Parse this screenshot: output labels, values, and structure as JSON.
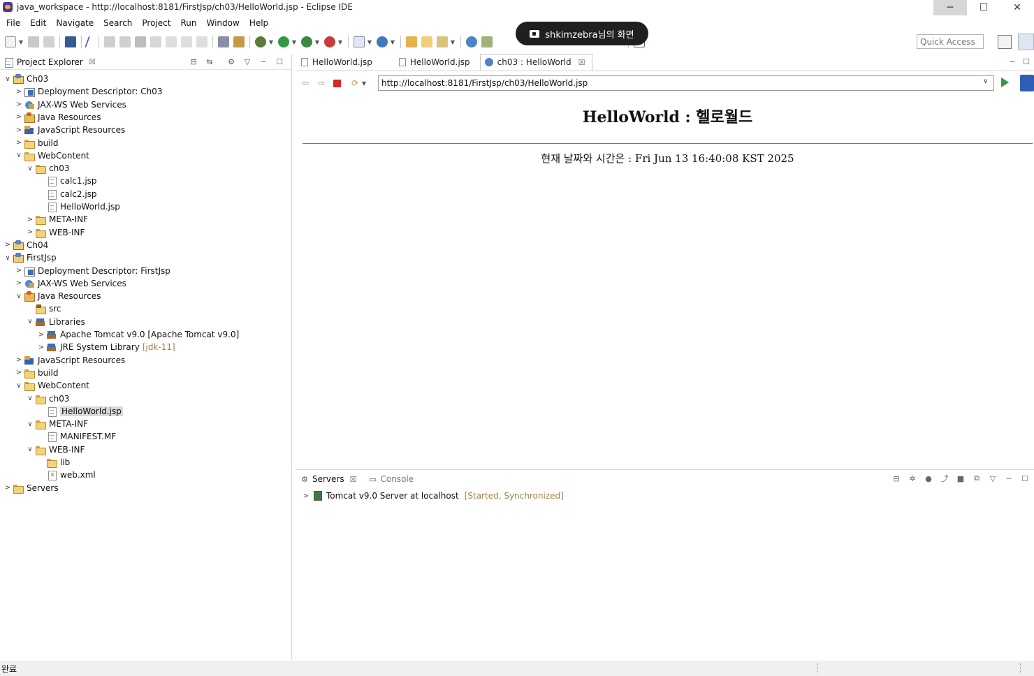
{
  "window": {
    "title": "java_workspace - http://localhost:8181/FirstJsp/ch03/HelloWorld.jsp - Eclipse IDE",
    "controls": {
      "minimize": "─",
      "maximize": "☐",
      "close": "✕"
    }
  },
  "menu": [
    "File",
    "Edit",
    "Navigate",
    "Search",
    "Project",
    "Run",
    "Window",
    "Help"
  ],
  "share_badge": {
    "text": "shkimzebra님의 화면"
  },
  "toolbar": {
    "quick_access_placeholder": "Quick Access"
  },
  "project_explorer": {
    "title": "Project Explorer",
    "close": "☒",
    "tree": [
      {
        "label": "Ch03",
        "depth": 0,
        "twisty": "v",
        "icon": "project"
      },
      {
        "label": "Deployment Descriptor: Ch03",
        "depth": 1,
        "twisty": ">",
        "icon": "dd"
      },
      {
        "label": "JAX-WS Web Services",
        "depth": 1,
        "twisty": ">",
        "icon": "ws"
      },
      {
        "label": "Java Resources",
        "depth": 1,
        "twisty": ">",
        "icon": "jres"
      },
      {
        "label": "JavaScript Resources",
        "depth": 1,
        "twisty": ">",
        "icon": "jsres"
      },
      {
        "label": "build",
        "depth": 1,
        "twisty": ">",
        "icon": "folder"
      },
      {
        "label": "WebContent",
        "depth": 1,
        "twisty": "v",
        "icon": "folder"
      },
      {
        "label": "ch03",
        "depth": 2,
        "twisty": "v",
        "icon": "folder"
      },
      {
        "label": "calc1.jsp",
        "depth": 3,
        "twisty": "",
        "icon": "file"
      },
      {
        "label": "calc2.jsp",
        "depth": 3,
        "twisty": "",
        "icon": "file"
      },
      {
        "label": "HelloWorld.jsp",
        "depth": 3,
        "twisty": "",
        "icon": "file"
      },
      {
        "label": "META-INF",
        "depth": 2,
        "twisty": ">",
        "icon": "folder"
      },
      {
        "label": "WEB-INF",
        "depth": 2,
        "twisty": ">",
        "icon": "folder"
      },
      {
        "label": "Ch04",
        "depth": 0,
        "twisty": ">",
        "icon": "project"
      },
      {
        "label": "FirstJsp",
        "depth": 0,
        "twisty": "v",
        "icon": "project"
      },
      {
        "label": "Deployment Descriptor: FirstJsp",
        "depth": 1,
        "twisty": ">",
        "icon": "dd"
      },
      {
        "label": "JAX-WS Web Services",
        "depth": 1,
        "twisty": ">",
        "icon": "ws"
      },
      {
        "label": "Java Resources",
        "depth": 1,
        "twisty": "v",
        "icon": "jres"
      },
      {
        "label": "src",
        "depth": 2,
        "twisty": "",
        "icon": "srcf"
      },
      {
        "label": "Libraries",
        "depth": 2,
        "twisty": "v",
        "icon": "lib"
      },
      {
        "label": "Apache Tomcat v9.0 [Apache Tomcat v9.0]",
        "depth": 3,
        "twisty": ">",
        "icon": "lib"
      },
      {
        "label": "JRE System Library",
        "suffix": "[jdk-11]",
        "depth": 3,
        "twisty": ">",
        "icon": "lib"
      },
      {
        "label": "JavaScript Resources",
        "depth": 1,
        "twisty": ">",
        "icon": "jsres"
      },
      {
        "label": "build",
        "depth": 1,
        "twisty": ">",
        "icon": "folder"
      },
      {
        "label": "WebContent",
        "depth": 1,
        "twisty": "v",
        "icon": "folder"
      },
      {
        "label": "ch03",
        "depth": 2,
        "twisty": "v",
        "icon": "folder"
      },
      {
        "label": "HelloWorld.jsp",
        "depth": 3,
        "twisty": "",
        "icon": "file",
        "selected": true
      },
      {
        "label": "META-INF",
        "depth": 2,
        "twisty": "v",
        "icon": "folder"
      },
      {
        "label": "MANIFEST.MF",
        "depth": 3,
        "twisty": "",
        "icon": "file"
      },
      {
        "label": "WEB-INF",
        "depth": 2,
        "twisty": "v",
        "icon": "folder"
      },
      {
        "label": "lib",
        "depth": 3,
        "twisty": "",
        "icon": "folder"
      },
      {
        "label": "web.xml",
        "depth": 3,
        "twisty": "",
        "icon": "xml"
      },
      {
        "label": "Servers",
        "depth": 0,
        "twisty": ">",
        "icon": "folder"
      }
    ]
  },
  "editor": {
    "tabs": [
      {
        "label": "HelloWorld.jsp",
        "icon": "file",
        "active": false
      },
      {
        "label": "HelloWorld.jsp",
        "icon": "file",
        "active": false
      },
      {
        "label": "ch03 : HelloWorld",
        "icon": "globe",
        "active": true,
        "close": "☒"
      }
    ],
    "url": "http://localhost:8181/FirstJsp/ch03/HelloWorld.jsp",
    "page": {
      "heading": "HelloWorld : 헬로월드",
      "date_line": "현재 날짜와 시간은 : Fri Jun 13 16:40:08 KST 2025"
    }
  },
  "servers_panel": {
    "tabs": [
      {
        "label": "Servers",
        "close": "☒"
      },
      {
        "label": "Console"
      }
    ],
    "server": {
      "name": "Tomcat v9.0 Server at localhost",
      "status": "[Started, Synchronized]"
    }
  },
  "statusbar": {
    "text": "완료"
  }
}
